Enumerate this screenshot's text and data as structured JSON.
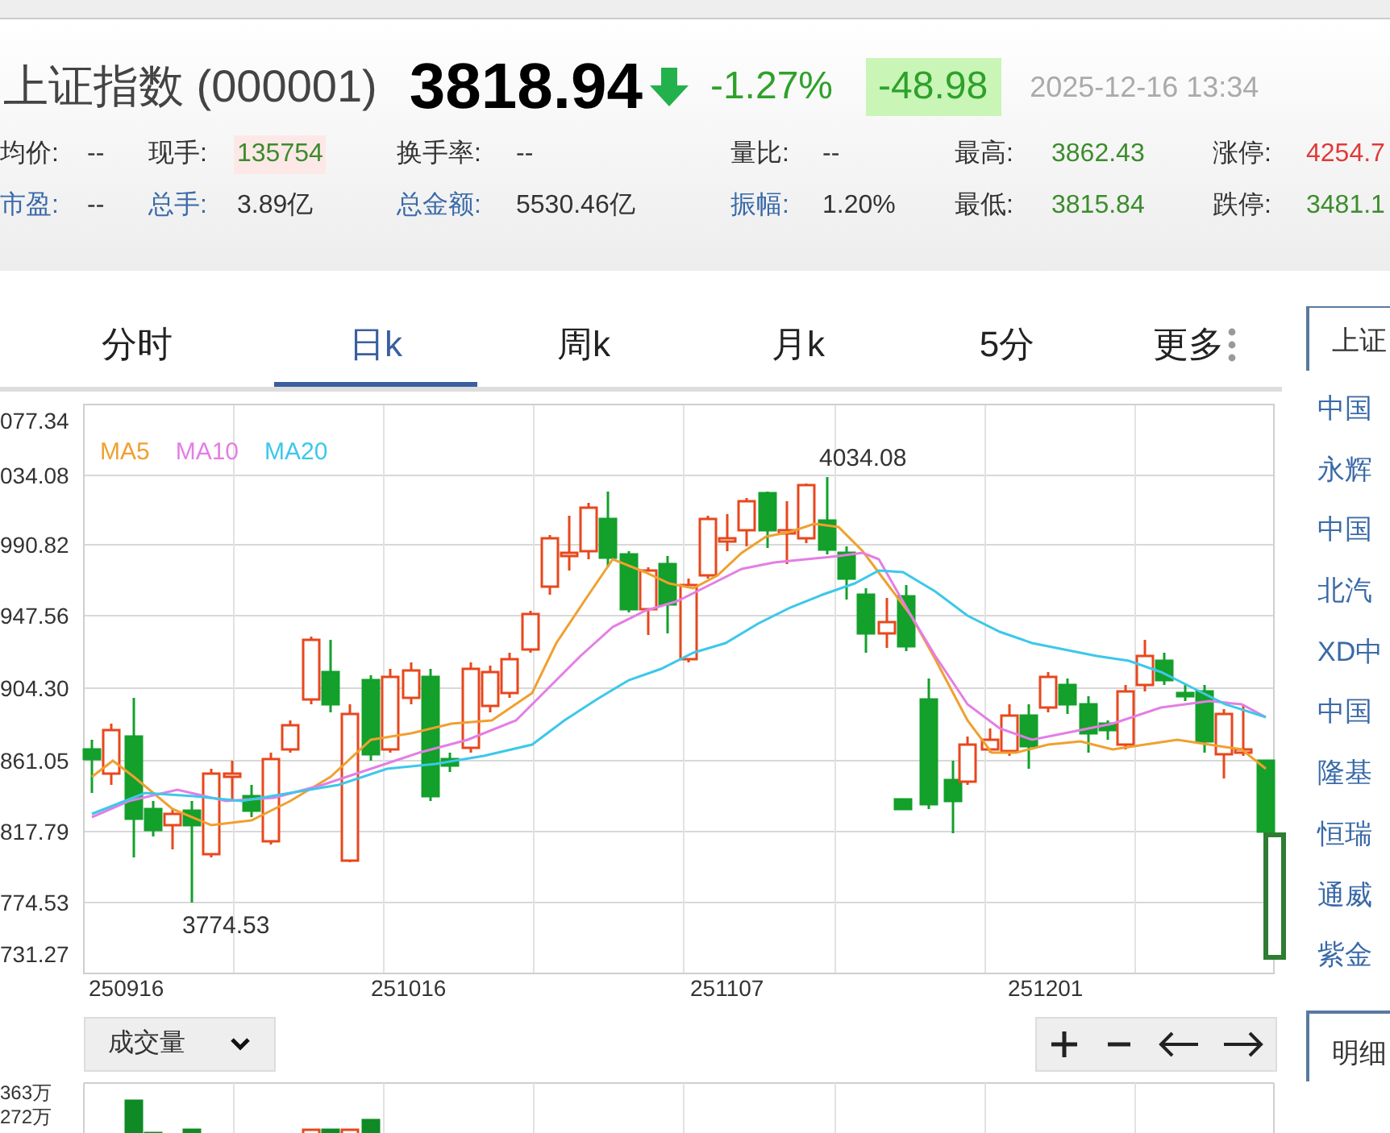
{
  "header": {
    "title": "上证指数 (000001)",
    "price": "3818.94",
    "falling": true,
    "change_percent": "-1.27%",
    "change": "-48.98",
    "datetime": "2025-12-16 13:34"
  },
  "stats": [
    [
      {
        "label": "均价:",
        "value": "--",
        "link": false,
        "color": "#333333",
        "highlighted": false
      },
      {
        "label": "现手:",
        "value": "135754",
        "link": false,
        "color": "#3c8c2c",
        "highlighted": true
      },
      {
        "label": "换手率:",
        "value": "--",
        "link": false,
        "color": "#333333",
        "highlighted": false
      },
      {
        "label": "量比:",
        "value": "--",
        "link": false,
        "color": "#333333",
        "highlighted": false
      },
      {
        "label": "最高:",
        "value": "3862.43",
        "link": false,
        "color": "#3c8c2c",
        "highlighted": false
      },
      {
        "label": "涨停:",
        "value": "4254.7",
        "link": false,
        "color": "#e03a3a",
        "highlighted": false
      }
    ],
    [
      {
        "label": "市盈:",
        "value": "--",
        "link": true,
        "color": "#333333",
        "highlighted": false
      },
      {
        "label": "总手:",
        "value": "3.89亿",
        "link": true,
        "color": "#333333",
        "highlighted": false
      },
      {
        "label": "总金额:",
        "value": "5530.46亿",
        "link": true,
        "color": "#333333",
        "highlighted": false
      },
      {
        "label": "振幅:",
        "value": "1.20%",
        "link": true,
        "color": "#333333",
        "highlighted": false
      },
      {
        "label": "最低:",
        "value": "3815.84",
        "link": false,
        "color": "#3c8c2c",
        "highlighted": false
      },
      {
        "label": "跌停:",
        "value": "3481.1",
        "link": false,
        "color": "#3c8c2c",
        "highlighted": false
      }
    ]
  ],
  "tabs": [
    {
      "label": "分时",
      "selected": false,
      "kind": "period"
    },
    {
      "label": "日k",
      "selected": true,
      "kind": "period"
    },
    {
      "label": "周k",
      "selected": false,
      "kind": "period"
    },
    {
      "label": "月k",
      "selected": false,
      "kind": "period"
    },
    {
      "label": "5分",
      "selected": false,
      "kind": "period"
    },
    {
      "label": "更多",
      "selected": false,
      "kind": "menu"
    }
  ],
  "chart": {
    "legend": [
      {
        "label": "MA5",
        "color": "#f0a030"
      },
      {
        "label": "MA10",
        "color": "#e47ee4"
      },
      {
        "label": "MA20",
        "color": "#3cc8ea"
      }
    ],
    "y_labels": [
      "077.34",
      "034.08",
      "990.82",
      "947.56",
      "904.30",
      "861.05",
      "817.79",
      "774.53",
      "731.27"
    ],
    "x_labels": [
      "250916",
      "251016",
      "251107",
      "251201"
    ],
    "high_label": "4034.08",
    "low_label": "3774.53"
  },
  "indicator": {
    "value": "成交量"
  },
  "volume": {
    "y_labels": [
      "363万",
      "272万"
    ]
  },
  "sidebar": {
    "tab": "上证",
    "stocks": [
      "中国",
      "永辉",
      "中国",
      "北汽",
      "XD中",
      "中国",
      "隆基",
      "恒瑞",
      "通威",
      "紫金"
    ],
    "bottom_tab": "明细"
  }
}
